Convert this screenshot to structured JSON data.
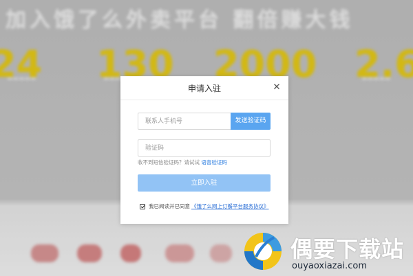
{
  "background": {
    "headline": "加入饿了么外卖平台 翻倍赚大钱",
    "stats": [
      "24",
      "130",
      "2000",
      "2.6"
    ]
  },
  "modal": {
    "title": "申请入驻",
    "phone_placeholder": "联系人手机号",
    "send_code_label": "发送验证码",
    "code_placeholder": "验证码",
    "hint_text": "收不到短信验证码？请试试",
    "hint_link": "语音验证码",
    "submit_label": "立即入驻",
    "agree_text": "我已阅读并已同意",
    "agree_link": "《饿了么网上订餐平台服务协议》",
    "agree_checked": true
  },
  "watermark": {
    "title": "偶要下载站",
    "url": "ouyaoxiazai.com"
  },
  "colors": {
    "primary": "#5aa5f0",
    "primary_disabled": "#92c3f5",
    "link": "#2f7fe0",
    "stat_yellow": "#e8c800"
  }
}
